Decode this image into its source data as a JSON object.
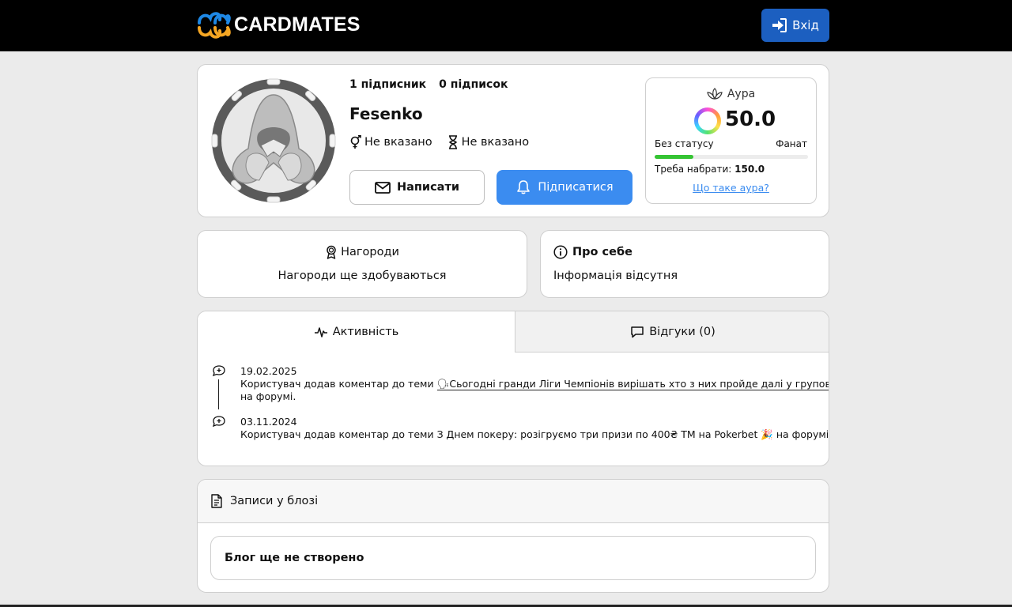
{
  "header": {
    "logo_text": "CARDMATES",
    "login_label": "Вхід",
    "login_icon": "sign-in-icon"
  },
  "profile": {
    "followers": "1 підписник",
    "following": "0 підписок",
    "username": "Fesenko",
    "gender": "Не вказано",
    "age": "Не вказано",
    "write_label": "Написати",
    "subscribe_label": "Підписатися",
    "accent_color": "#3b8cf0"
  },
  "aura": {
    "title": "Аура",
    "value": "50.0",
    "status": "Без статусу",
    "next_level": "Фанат",
    "progress_fraction": 0.25,
    "need_label": "Треба набрати:",
    "need_value": "150.0",
    "link": "Що таке аура?"
  },
  "awards": {
    "title": "Нагороди",
    "text": "Нагороди ще здобуваються"
  },
  "about": {
    "title": "Про себе",
    "text": "Інформація відсутня"
  },
  "tabs": {
    "activity": "Активність",
    "reviews": "Відгуки (0)"
  },
  "activity": [
    {
      "date": "19.02.2025",
      "prefix": "Користувач додав коментар до теми ",
      "topic": "🗣Сьогодні гранди Ліги Чемпіонів вирішать хто з них пройде далі у груповий етап",
      "suffix": "на форумі."
    },
    {
      "date": "03.11.2024",
      "prefix": "Користувач додав коментар до теми ",
      "topic": "З Днем покеру: розігруємо три призи по 400₴ ТМ на Pokerbet 🎉",
      "suffix": " на форумі."
    }
  ],
  "blog": {
    "title": "Записи у блозі",
    "empty": "Блог ще не створено"
  }
}
